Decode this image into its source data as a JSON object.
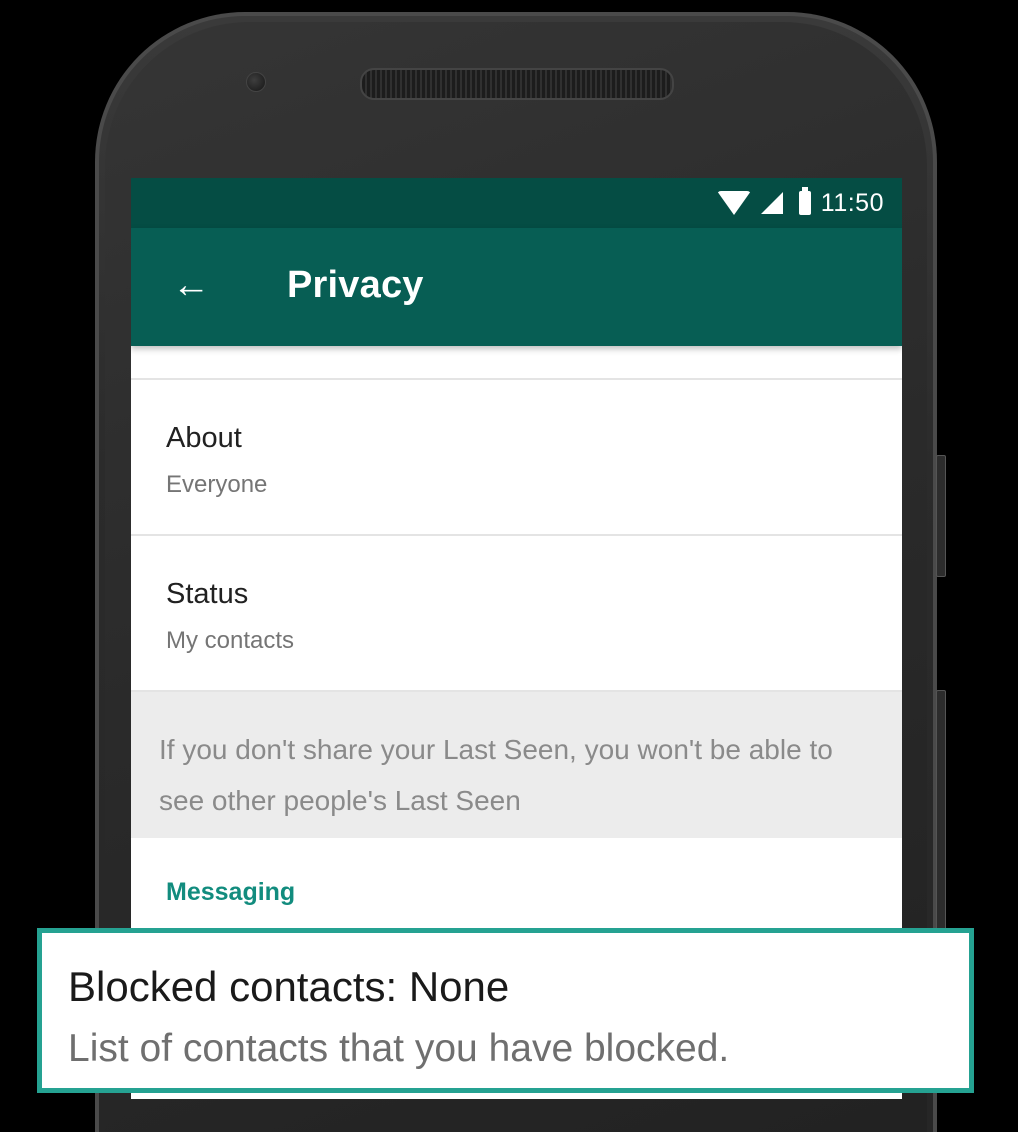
{
  "status_bar": {
    "time": "11:50",
    "icons": [
      "wifi-icon",
      "signal-icon",
      "battery-icon"
    ]
  },
  "app_bar": {
    "back_icon": "←",
    "title": "Privacy"
  },
  "settings": {
    "about": {
      "title": "About",
      "value": "Everyone"
    },
    "status": {
      "title": "Status",
      "value": "My contacts"
    },
    "info_text": "If you don't share your Last Seen, you won't be able to see other people's Last Seen",
    "section_messaging": "Messaging"
  },
  "callout": {
    "title": "Blocked contacts: None",
    "subtitle": "List of contacts that you have blocked."
  },
  "colors": {
    "status_bar": "#054d44",
    "app_bar": "#075e54",
    "accent": "#128c7e",
    "callout_border": "#25a292"
  }
}
